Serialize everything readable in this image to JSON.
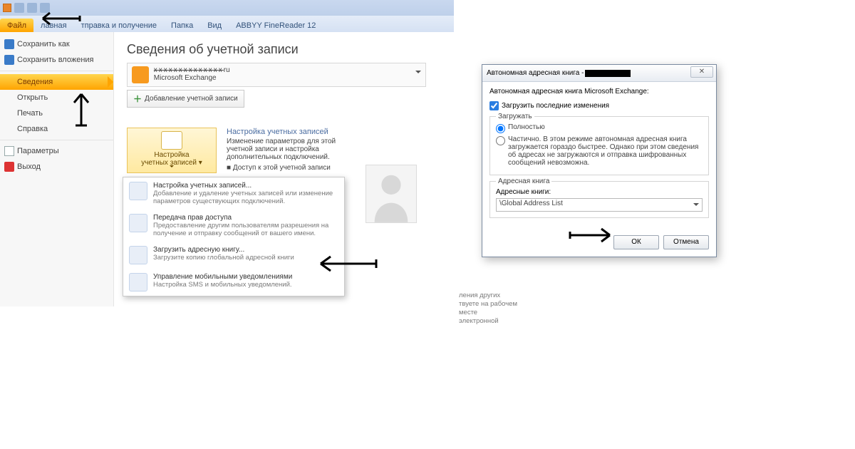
{
  "ribbon": {
    "tabs": [
      "Файл",
      "лавная",
      "тправка и получение",
      "Папка",
      "Вид",
      "ABBYY FineReader 12"
    ]
  },
  "nav": {
    "save_as": "Сохранить как",
    "save_attachments": "Сохранить вложения",
    "info": "Сведения",
    "open": "Открыть",
    "print": "Печать",
    "help": "Справка",
    "options": "Параметры",
    "exit": "Выход"
  },
  "info_page": {
    "title": "Сведения об учетной записи",
    "account": {
      "email_suffix": "ru",
      "service": "Microsoft Exchange"
    },
    "add_account_btn": "Добавление учетной записи",
    "settings_btn": {
      "line1": "Настройка",
      "line2": "учетных записей"
    },
    "settings_text": {
      "title": "Настройка учетных записей",
      "line1": "Изменение параметров для этой",
      "line2": "учетной записи и настройка",
      "line3": "дополнительных подключений.",
      "line4": "Доступ к этой учетной записи"
    },
    "behind_text": {
      "l1": "ления других",
      "l2": "твуете на рабочем",
      "l3": "месте",
      "l4": "электронной"
    }
  },
  "dropdown": {
    "items": [
      {
        "title": "Настройка учетных записей...",
        "sub": "Добавление и удаление учетных записей или изменение параметров существующих подключений."
      },
      {
        "title": "Передача прав доступа",
        "sub": "Предоставление другим пользователям разрешения на получение и отправку сообщений от вашего имени."
      },
      {
        "title": "Загрузить адресную книгу...",
        "sub": "Загрузите копию глобальной адресной книги"
      },
      {
        "title": "Управление мобильными уведомлениями",
        "sub": "Настройка SMS и мобильных уведомлений."
      }
    ]
  },
  "dialog": {
    "title_prefix": "Автономная адресная книга -",
    "label": "Автономная адресная книга Microsoft Exchange:",
    "checkbox": "Загрузить последние изменения",
    "load_group": "Загружать",
    "radio_full": "Полностью",
    "radio_partial": "Частично. В этом режиме автономная адресная книга загружается гораздо быстрее. Однако при этом сведения об адресах не загружаются и отправка шифрованных сообщений невозможна.",
    "book_group": "Адресная книга",
    "book_label": "Адресные книги:",
    "book_value": "\\Global Address List",
    "ok": "ОК",
    "cancel": "Отмена"
  }
}
